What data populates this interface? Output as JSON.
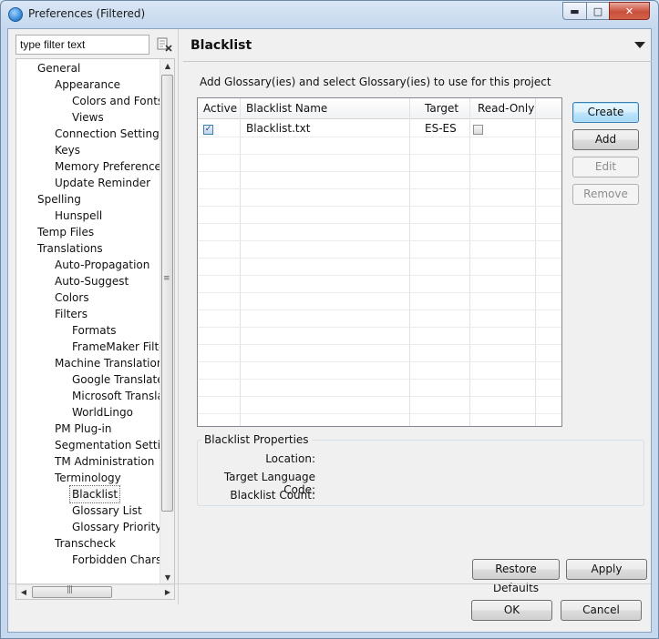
{
  "window": {
    "title": "Preferences (Filtered)",
    "minimize_glyph": "▬",
    "maximize_glyph": "□",
    "close_glyph": "✕"
  },
  "filter": {
    "value": "type filter text",
    "clear_icon": "clear-filter-icon"
  },
  "tree": {
    "items": [
      {
        "label": "General",
        "level": 1
      },
      {
        "label": "Appearance",
        "level": 2
      },
      {
        "label": "Colors and Fonts",
        "level": 3
      },
      {
        "label": "Views",
        "level": 3
      },
      {
        "label": "Connection Settings",
        "level": 2
      },
      {
        "label": "Keys",
        "level": 2
      },
      {
        "label": "Memory Preferences",
        "level": 2
      },
      {
        "label": "Update Reminder",
        "level": 2
      },
      {
        "label": "Spelling",
        "level": 1
      },
      {
        "label": "Hunspell",
        "level": 2
      },
      {
        "label": "Temp Files",
        "level": 1
      },
      {
        "label": "Translations",
        "level": 1
      },
      {
        "label": "Auto-Propagation",
        "level": 2
      },
      {
        "label": "Auto-Suggest",
        "level": 2
      },
      {
        "label": "Colors",
        "level": 2
      },
      {
        "label": "Filters",
        "level": 2
      },
      {
        "label": "Formats",
        "level": 3
      },
      {
        "label": "FrameMaker Filter",
        "level": 3
      },
      {
        "label": "Machine Translation",
        "level": 2
      },
      {
        "label": "Google Translate",
        "level": 3
      },
      {
        "label": "Microsoft Translat",
        "level": 3
      },
      {
        "label": "WorldLingo",
        "level": 3
      },
      {
        "label": "PM Plug-in",
        "level": 2
      },
      {
        "label": "Segmentation Settings",
        "level": 2
      },
      {
        "label": "TM Administration",
        "level": 2
      },
      {
        "label": "Terminology",
        "level": 2
      },
      {
        "label": "Blacklist",
        "level": 3,
        "selected": true
      },
      {
        "label": "Glossary List",
        "level": 3
      },
      {
        "label": "Glossary Priority",
        "level": 3
      },
      {
        "label": "Transcheck",
        "level": 2
      },
      {
        "label": "Forbidden Chars",
        "level": 3
      }
    ],
    "scroll_up": "▲",
    "scroll_down": "▼",
    "scroll_left": "◀",
    "scroll_right": "▶",
    "vgrip": "≡",
    "hgrip": "|||"
  },
  "page": {
    "title": "Blacklist",
    "description": "Add Glossary(ies) and select Glossary(ies) to use for this project"
  },
  "table": {
    "columns": [
      "Active",
      "Blacklist Name",
      "Target",
      "Read-Only"
    ],
    "rows": [
      {
        "active": true,
        "name": "Blacklist.txt",
        "target": "ES-ES",
        "read_only": false
      }
    ],
    "check_glyph": "✓"
  },
  "side_buttons": {
    "create": "Create",
    "add": "Add",
    "edit": "Edit",
    "remove": "Remove"
  },
  "properties": {
    "title": "Blacklist Properties",
    "location_label": "Location:",
    "target_language_label": "Target Language Code:",
    "count_label": "Blacklist Count:"
  },
  "page_buttons": {
    "restore_defaults": "Restore Defaults",
    "apply": "Apply"
  },
  "dialog_buttons": {
    "ok": "OK",
    "cancel": "Cancel"
  }
}
